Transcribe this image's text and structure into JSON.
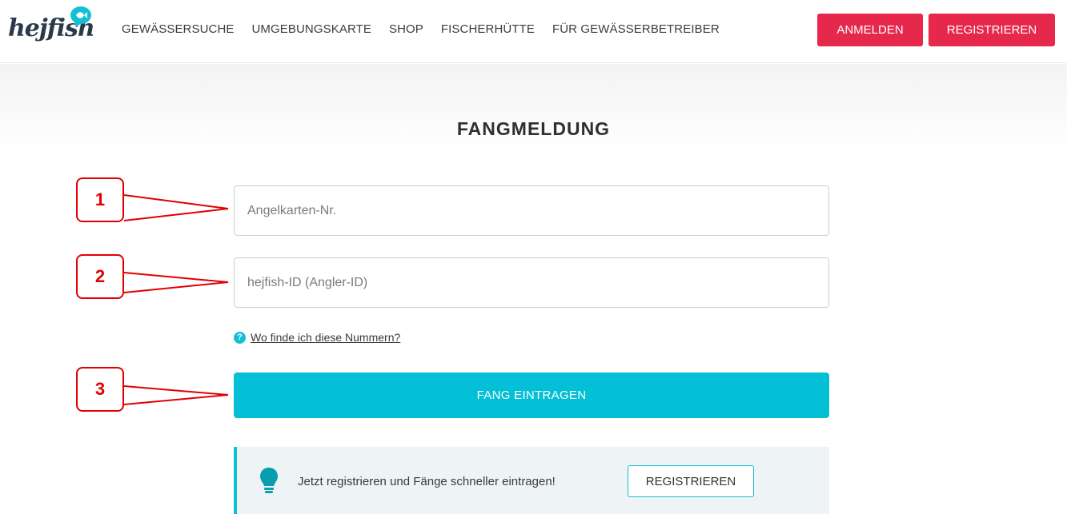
{
  "brand": {
    "logo_text": "hejfish"
  },
  "nav": {
    "items": [
      "GEWÄSSERSUCHE",
      "UMGEBUNGSKARTE",
      "SHOP",
      "FISCHERHÜTTE",
      "FÜR GEWÄSSERBETREIBER"
    ]
  },
  "auth": {
    "login_label": "ANMELDEN",
    "register_label": "REGISTRIEREN"
  },
  "page": {
    "title": "FANGMELDUNG"
  },
  "form": {
    "ticket_placeholder": "Angelkarten-Nr.",
    "id_placeholder": "hejfish-ID (Angler-ID)",
    "help_icon_glyph": "?",
    "help_link": "Wo finde ich diese Nummern?",
    "submit_label": "FANG EINTRAGEN"
  },
  "info": {
    "text": "Jetzt registrieren und Fänge schneller eintragen!",
    "button_label": "REGISTRIEREN"
  },
  "callouts": [
    "1",
    "2",
    "3"
  ],
  "colors": {
    "accent": "#03c0d6",
    "brand_red": "#e6284d",
    "callout_red": "#e10000",
    "info_bg": "#eef4f6"
  },
  "icons": {
    "logo_bubble": "fish-bubble-icon",
    "help": "question-circle-icon",
    "info": "lightbulb-icon"
  }
}
